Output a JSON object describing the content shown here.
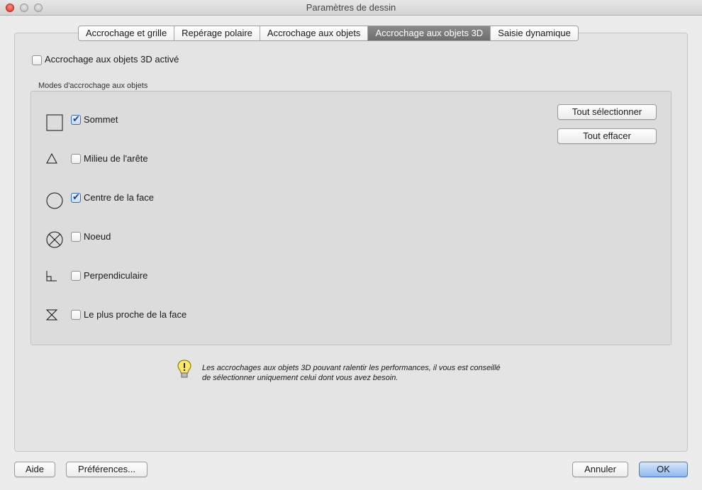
{
  "window": {
    "title": "Paramètres de dessin"
  },
  "tabs": [
    {
      "label": "Accrochage et grille",
      "active": false
    },
    {
      "label": "Repérage polaire",
      "active": false
    },
    {
      "label": "Accrochage aux objets",
      "active": false
    },
    {
      "label": "Accrochage aux objets 3D",
      "active": true
    },
    {
      "label": "Saisie dynamique",
      "active": false
    }
  ],
  "enable_3d_snap": {
    "label": "Accrochage aux objets 3D activé",
    "checked": false
  },
  "modes_group": {
    "title": "Modes d'accrochage aux objets",
    "items": [
      {
        "label": "Sommet",
        "checked": true,
        "icon": "square-marker-icon"
      },
      {
        "label": "Milieu de l'arête",
        "checked": false,
        "icon": "triangle-marker-icon"
      },
      {
        "label": "Centre de la face",
        "checked": true,
        "icon": "circle-marker-icon"
      },
      {
        "label": "Noeud",
        "checked": false,
        "icon": "node-marker-icon"
      },
      {
        "label": "Perpendiculaire",
        "checked": false,
        "icon": "perpendicular-marker-icon"
      },
      {
        "label": "Le plus proche de la face",
        "checked": false,
        "icon": "nearest-marker-icon"
      }
    ],
    "select_all_label": "Tout sélectionner",
    "clear_all_label": "Tout effacer"
  },
  "hint": {
    "icon": "lightbulb-icon",
    "line1": "Les accrochages aux objets 3D pouvant ralentir les performances, il vous est conseillé",
    "line2": "de sélectionner uniquement celui dont vous avez besoin."
  },
  "footer": {
    "help_label": "Aide",
    "preferences_label": "Préférences...",
    "cancel_label": "Annuler",
    "ok_label": "OK"
  },
  "colors": {
    "active_tab": "#7a7a7a",
    "check_accent": "#3a6bb5",
    "ok_button": "#8fb8ee"
  }
}
